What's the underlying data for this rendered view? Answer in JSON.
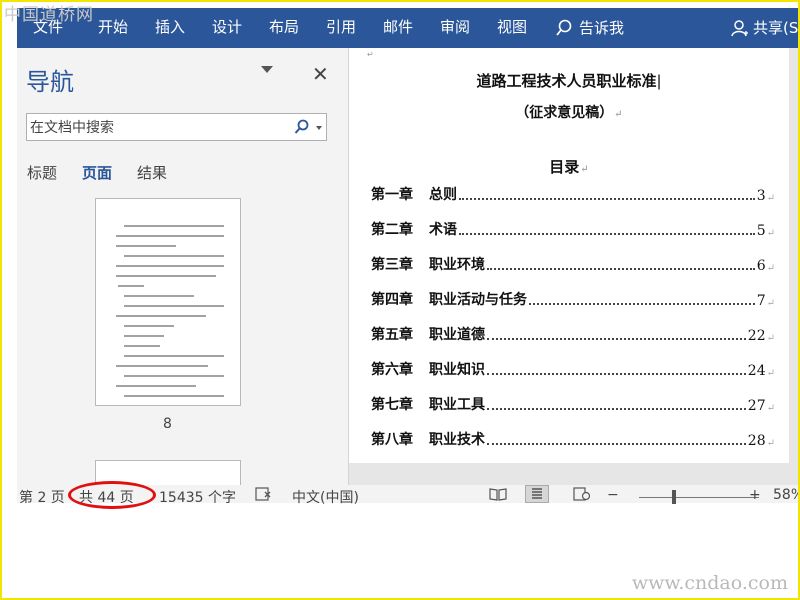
{
  "watermark": {
    "top": "中国道桥网",
    "bottom": "www.cndao.com"
  },
  "ribbon": {
    "tabs": [
      "文件",
      "开始",
      "插入",
      "设计",
      "布局",
      "引用",
      "邮件",
      "审阅",
      "视图"
    ],
    "tell_me": "告诉我",
    "share": "共享(S",
    "color": "#2b579a"
  },
  "nav_pane": {
    "title": "导航",
    "search_placeholder": "在文档中搜索",
    "tabs": [
      "标题",
      "页面",
      "结果"
    ],
    "active_tab": "页面",
    "thumbnail_page_number": "8"
  },
  "document": {
    "title": "道路工程技术人员职业标准",
    "subtitle": "（征求意见稿）",
    "toc_heading": "目录",
    "toc": [
      {
        "chapter": "第一章",
        "title": "总则",
        "page": "3"
      },
      {
        "chapter": "第二章",
        "title": "术语",
        "page": "5"
      },
      {
        "chapter": "第三章",
        "title": "职业环境",
        "page": "6"
      },
      {
        "chapter": "第四章",
        "title": "职业活动与任务",
        "page": "7"
      },
      {
        "chapter": "第五章",
        "title": "职业道德",
        "page": "22"
      },
      {
        "chapter": "第六章",
        "title": "职业知识",
        "page": "24"
      },
      {
        "chapter": "第七章",
        "title": "职业工具",
        "page": "27"
      },
      {
        "chapter": "第八章",
        "title": "职业技术",
        "page": "28"
      }
    ]
  },
  "status_bar": {
    "page": "第 2 页",
    "total_pages": "共 44 页",
    "word_count": "15435 个字",
    "language": "中文(中国)",
    "zoom": "58%",
    "zoom_minus": "−",
    "zoom_plus": "+"
  }
}
